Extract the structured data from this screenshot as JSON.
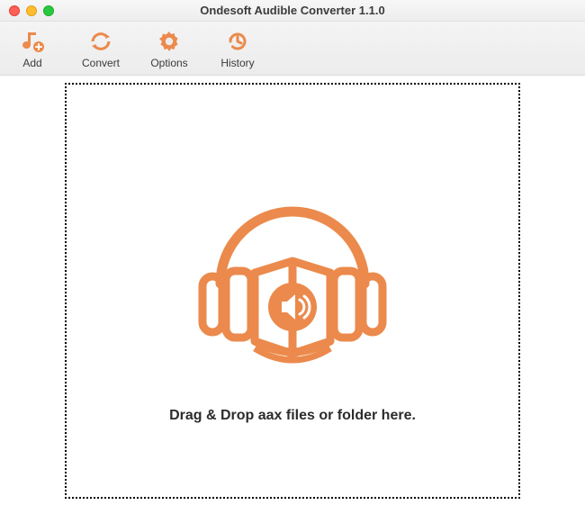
{
  "window": {
    "title": "Ondesoft Audible Converter 1.1.0"
  },
  "toolbar": {
    "add_label": "Add",
    "convert_label": "Convert",
    "options_label": "Options",
    "history_label": "History"
  },
  "dropzone": {
    "text": "Drag & Drop aax files or folder here."
  },
  "colors": {
    "accent": "#eb8a4c",
    "text": "#2c2c2c"
  }
}
